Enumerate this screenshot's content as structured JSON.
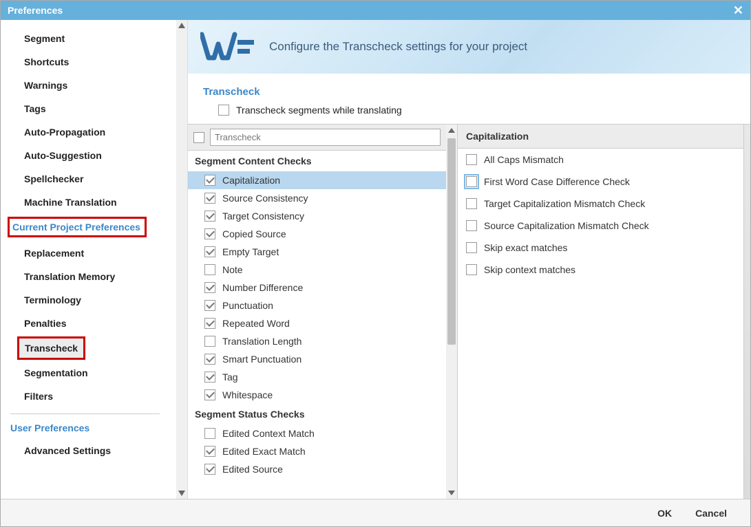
{
  "title": "Preferences",
  "close_glyph": "✕",
  "banner": {
    "title": "Configure the Transcheck settings for your project"
  },
  "sidebar": {
    "general_items": [
      "Segment",
      "Shortcuts",
      "Warnings",
      "Tags",
      "Auto-Propagation",
      "Auto-Suggestion",
      "Spellchecker",
      "Machine Translation"
    ],
    "project_header": "Current Project Preferences",
    "project_items": [
      "Replacement",
      "Translation Memory",
      "Terminology",
      "Penalties",
      "Transcheck",
      "Segmentation",
      "Filters"
    ],
    "project_selected_index": 4,
    "user_header": "User Preferences",
    "user_items": [
      "Advanced Settings"
    ]
  },
  "transcheck": {
    "section_label": "Transcheck",
    "while_translating_label": "Transcheck segments while translating",
    "while_translating_checked": false,
    "filter_master_checked": false,
    "filter_placeholder": "Transcheck",
    "groups": [
      {
        "header": "Segment Content Checks",
        "items": [
          {
            "label": "Capitalization",
            "checked": true,
            "selected": true
          },
          {
            "label": "Source Consistency",
            "checked": true
          },
          {
            "label": "Target Consistency",
            "checked": true
          },
          {
            "label": "Copied Source",
            "checked": true
          },
          {
            "label": "Empty Target",
            "checked": true
          },
          {
            "label": "Note",
            "checked": false
          },
          {
            "label": "Number Difference",
            "checked": true
          },
          {
            "label": "Punctuation",
            "checked": true
          },
          {
            "label": "Repeated Word",
            "checked": true
          },
          {
            "label": "Translation Length",
            "checked": false
          },
          {
            "label": "Smart Punctuation",
            "checked": true
          },
          {
            "label": "Tag",
            "checked": true
          },
          {
            "label": "Whitespace",
            "checked": true
          }
        ]
      },
      {
        "header": "Segment Status Checks",
        "items": [
          {
            "label": "Edited Context Match",
            "checked": false
          },
          {
            "label": "Edited Exact Match",
            "checked": true
          },
          {
            "label": "Edited Source",
            "checked": true
          }
        ]
      }
    ]
  },
  "detail": {
    "header": "Capitalization",
    "options": [
      {
        "label": "All Caps Mismatch",
        "checked": false
      },
      {
        "label": "First Word Case Difference Check",
        "checked": false,
        "highlight": true
      },
      {
        "label": "Target Capitalization Mismatch Check",
        "checked": false
      },
      {
        "label": "Source Capitalization Mismatch Check",
        "checked": false
      },
      {
        "label": "Skip exact matches",
        "checked": false
      },
      {
        "label": "Skip context matches",
        "checked": false
      }
    ]
  },
  "footer": {
    "ok": "OK",
    "cancel": "Cancel"
  }
}
